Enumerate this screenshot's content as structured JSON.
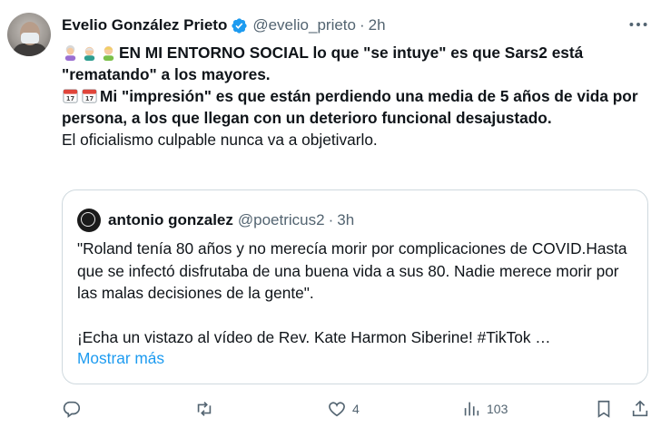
{
  "tweet": {
    "author_name": "Evelio González Prieto",
    "handle": "@evelio_prieto",
    "separator": "·",
    "time": "2h",
    "line1": "EN MI ENTORNO SOCIAL lo que \"se intuye\" es que Sars2 está \"rematando\" a los mayores.",
    "line2": "Mi \"impresión\" es que están perdiendo una media de 5 años de vida por persona, a los que llegan con un deterioro funcional desajustado.",
    "line3": "El oficialismo culpable nunca va a objetivarlo."
  },
  "quote": {
    "author_name": "antonio gonzalez",
    "handle": "@poetricus2",
    "separator": "·",
    "time": "3h",
    "p1": "\"Roland tenía 80 años y no merecía morir por complicaciones de COVID.Hasta que se infectó disfrutaba de una buena vida a sus 80. Nadie merece morir por las malas decisiones de la gente\".",
    "p2": "¡Echa un vistazo al vídeo de Rev. Kate Harmon Siberine! #TikTok …",
    "show_more": "Mostrar más",
    "avatar_text": "LONG COVID"
  },
  "actions": {
    "replies": "",
    "retweets": "",
    "likes": "4",
    "views": "103"
  },
  "colors": {
    "accent": "#1d9bf0",
    "muted": "#536471",
    "border": "#cfd9de"
  },
  "icons": [
    "verified-badge-icon",
    "more-icon",
    "old-woman-emoji",
    "old-man-emoji",
    "person-emoji",
    "calendar-emoji",
    "reply-icon",
    "retweet-icon",
    "like-icon",
    "views-icon",
    "bookmark-icon",
    "share-icon"
  ]
}
